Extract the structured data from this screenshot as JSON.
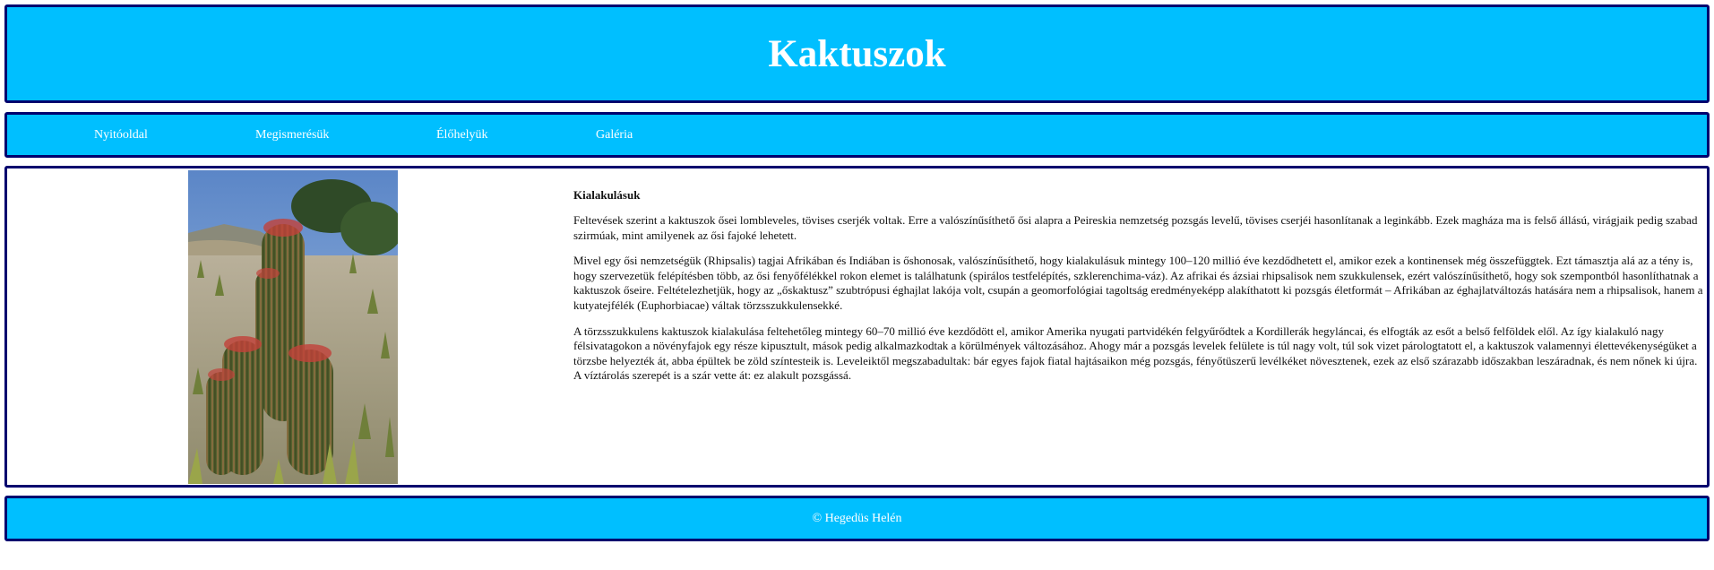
{
  "header": {
    "title": "Kaktuszok"
  },
  "nav": {
    "items": [
      {
        "label": "Nyitóoldal"
      },
      {
        "label": "Megismerésük"
      },
      {
        "label": "Élőhelyük"
      },
      {
        "label": "Galéria"
      }
    ]
  },
  "main": {
    "image": {
      "icon": "cactus-photo"
    },
    "heading": "Kialakulásuk",
    "paragraphs": [
      "Feltevések szerint a kaktuszok ősei lombleveles, tövises cserjék voltak. Erre a valószínűsíthető ősi alapra a Peireskia nemzetség pozsgás levelű, tövises cserjéi hasonlítanak a leginkább. Ezek magháza ma is felső állású, virágjaik pedig szabad szirmúak, mint amilyenek az ősi fajoké lehetett.",
      "Mivel egy ősi nemzetségük (Rhipsalis) tagjai Afrikában és Indiában is őshonosak, valószínűsíthető, hogy kialakulásuk mintegy 100–120 millió éve kezdődhetett el, amikor ezek a kontinensek még összefüggtek. Ezt támasztja alá az a tény is, hogy szervezetük felépítésben több, az ősi fenyőfélékkel rokon elemet is találhatunk (spirálos testfelépítés, szklerenchima-váz). Az afrikai és ázsiai rhipsalisok nem szukkulensek, ezért valószínűsíthető, hogy sok szempontból hasonlíthatnak a kaktuszok őseire. Feltételezhetjük, hogy az „őskaktusz” szubtrópusi éghajlat lakója volt, csupán a geomorfológiai tagoltság eredményeképp alakíthatott ki pozsgás életformát – Afrikában az éghajlatváltozás hatására nem a rhipsalisok, hanem a kutyatejfélék (Euphorbiacae) váltak törzsszukkulensekké.",
      "A törzsszukkulens kaktuszok kialakulása feltehetőleg mintegy 60–70 millió éve kezdődött el, amikor Amerika nyugati partvidékén felgyűrődtek a Kordillerák hegyláncai, és elfogták az esőt a belső felföldek elől. Az így kialakuló nagy félsivatagokon a növényfajok egy része kipusztult, mások pedig alkalmazkodtak a körülmények változásához. Ahogy már a pozsgás levelek felülete is túl nagy volt, túl sok vizet párologtatott el, a kaktuszok valamennyi élettevékenységüket a törzsbe helyezték át, abba épültek be zöld színtesteik is. Leveleiktől megszabadultak: bár egyes fajok fiatal hajtásaikon még pozsgás, fényőtüszerű levélkéket növesztenek, ezek az első szárazabb időszakban leszáradnak, és nem nőnek ki újra. A víztárolás szerepét is a szár vette át: ez alakult pozsgássá."
    ]
  },
  "footer": {
    "text": "© Hegedüs Helén"
  },
  "colors": {
    "accent": "#00bfff",
    "border": "#00006e",
    "text_light": "#ffffff"
  }
}
